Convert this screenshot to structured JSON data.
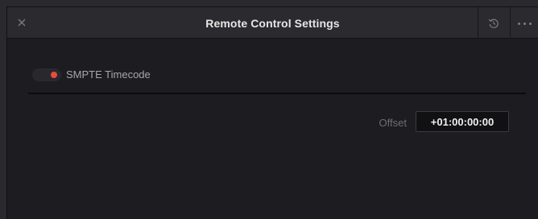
{
  "window": {
    "title": "Remote Control Settings"
  },
  "icons": {
    "close": "close-icon",
    "reset": "reset-icon",
    "more": "more-options-icon"
  },
  "smpte": {
    "label": "SMPTE Timecode",
    "enabled": true,
    "indicator_color": "#e74c3c"
  },
  "offset": {
    "label": "Offset",
    "value": "+01:00:00:00"
  }
}
